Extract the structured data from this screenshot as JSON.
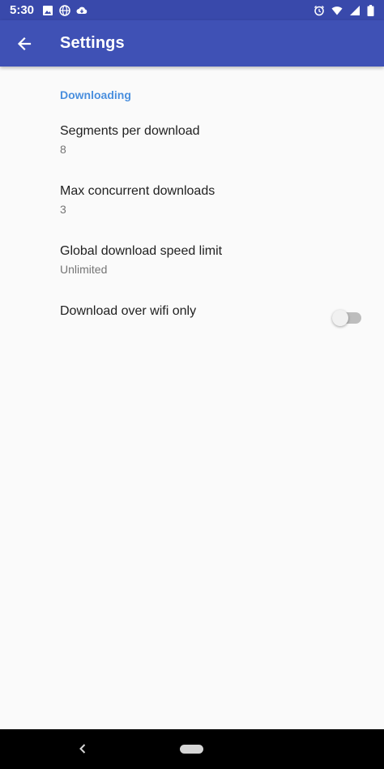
{
  "status_bar": {
    "time": "5:30",
    "icons_left": [
      "image-icon",
      "globe-icon",
      "cloud-download-icon"
    ],
    "icons_right": [
      "alarm-icon",
      "wifi-icon",
      "signal-icon",
      "battery-icon"
    ]
  },
  "app_bar": {
    "title": "Settings",
    "back_icon": "arrow-back-icon",
    "background": "#3f51b5"
  },
  "settings": {
    "category": "Downloading",
    "category_color": "#4a8fde",
    "items": [
      {
        "title": "Segments per download",
        "summary": "8"
      },
      {
        "title": "Max concurrent downloads",
        "summary": "3"
      },
      {
        "title": "Global download speed limit",
        "summary": "Unlimited"
      },
      {
        "title": "Download over wifi only",
        "switch_on": false
      }
    ]
  },
  "nav_bar": {
    "back_icon": "nav-back-icon",
    "home_icon": "nav-home-pill"
  }
}
